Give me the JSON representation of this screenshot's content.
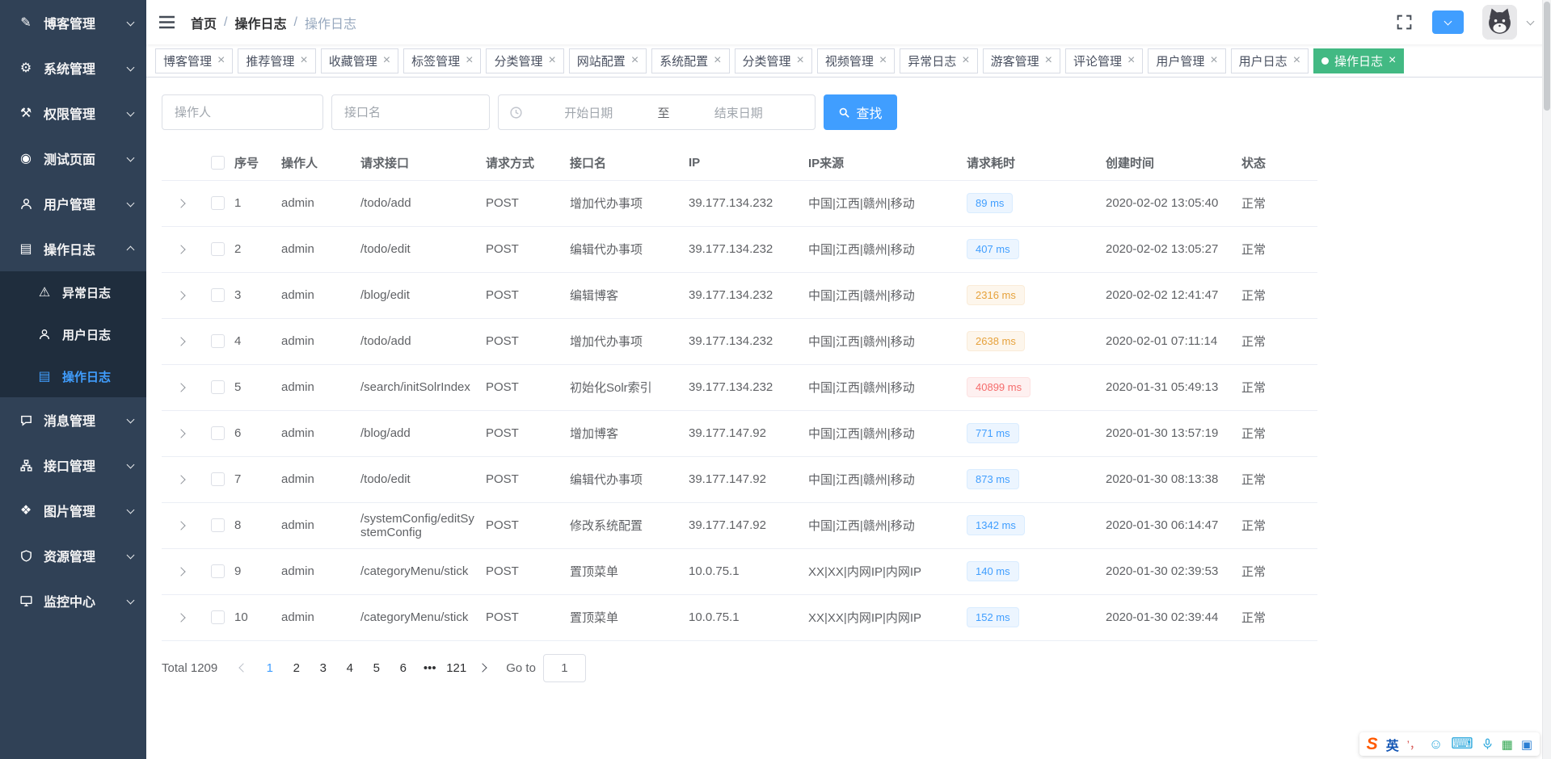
{
  "colors": {
    "primary": "#409eff",
    "active_tab_green": "#42b983",
    "sidebar_bg": "#304156",
    "submenu_bg": "#1f2d3d",
    "badge_info": "#409eff",
    "badge_warning": "#e6a23c",
    "badge_danger": "#f56c6c"
  },
  "header": {
    "breadcrumb": [
      "首页",
      "操作日志",
      "操作日志"
    ],
    "breadcrumb_separator": "/"
  },
  "sidebar": {
    "items": [
      {
        "label": "博客管理",
        "icon": "edit-icon"
      },
      {
        "label": "系统管理",
        "icon": "gear-icon"
      },
      {
        "label": "权限管理",
        "icon": "wrench-icon"
      },
      {
        "label": "测试页面",
        "icon": "target-icon"
      },
      {
        "label": "用户管理",
        "icon": "user-icon"
      },
      {
        "label": "操作日志",
        "icon": "log-icon",
        "expanded": true
      },
      {
        "label": "消息管理",
        "icon": "message-icon"
      },
      {
        "label": "接口管理",
        "icon": "api-icon"
      },
      {
        "label": "图片管理",
        "icon": "image-icon"
      },
      {
        "label": "资源管理",
        "icon": "shield-icon"
      },
      {
        "label": "监控中心",
        "icon": "monitor-icon"
      }
    ],
    "submenu": [
      {
        "label": "异常日志",
        "icon": "warning-icon"
      },
      {
        "label": "用户日志",
        "icon": "user-icon"
      },
      {
        "label": "操作日志",
        "icon": "log-icon",
        "active": true
      }
    ]
  },
  "tabs": [
    {
      "label": "博客管理"
    },
    {
      "label": "推荐管理"
    },
    {
      "label": "收藏管理"
    },
    {
      "label": "标签管理"
    },
    {
      "label": "分类管理"
    },
    {
      "label": "网站配置"
    },
    {
      "label": "系统配置"
    },
    {
      "label": "分类管理"
    },
    {
      "label": "视频管理"
    },
    {
      "label": "异常日志"
    },
    {
      "label": "游客管理"
    },
    {
      "label": "评论管理"
    },
    {
      "label": "用户管理"
    },
    {
      "label": "用户日志"
    },
    {
      "label": "操作日志",
      "active": true
    }
  ],
  "filters": {
    "operator_placeholder": "操作人",
    "api_placeholder": "接口名",
    "date_start_placeholder": "开始日期",
    "date_separator": "至",
    "date_end_placeholder": "结束日期",
    "search_label": "查找"
  },
  "table": {
    "columns": [
      "序号",
      "操作人",
      "请求接口",
      "请求方式",
      "接口名",
      "IP",
      "IP来源",
      "请求耗时",
      "创建时间",
      "状态"
    ],
    "rows": [
      {
        "seq": "1",
        "operator": "admin",
        "api": "/todo/add",
        "method": "POST",
        "api_name": "增加代办事项",
        "ip": "39.177.134.232",
        "ip_source": "中国|江西|赣州|移动",
        "duration": "89 ms",
        "duration_level": "info",
        "created": "2020-02-02 13:05:40",
        "status": "正常"
      },
      {
        "seq": "2",
        "operator": "admin",
        "api": "/todo/edit",
        "method": "POST",
        "api_name": "编辑代办事项",
        "ip": "39.177.134.232",
        "ip_source": "中国|江西|赣州|移动",
        "duration": "407 ms",
        "duration_level": "info",
        "created": "2020-02-02 13:05:27",
        "status": "正常"
      },
      {
        "seq": "3",
        "operator": "admin",
        "api": "/blog/edit",
        "method": "POST",
        "api_name": "编辑博客",
        "ip": "39.177.134.232",
        "ip_source": "中国|江西|赣州|移动",
        "duration": "2316 ms",
        "duration_level": "warning",
        "created": "2020-02-02 12:41:47",
        "status": "正常"
      },
      {
        "seq": "4",
        "operator": "admin",
        "api": "/todo/add",
        "method": "POST",
        "api_name": "增加代办事项",
        "ip": "39.177.134.232",
        "ip_source": "中国|江西|赣州|移动",
        "duration": "2638 ms",
        "duration_level": "warning",
        "created": "2020-02-01 07:11:14",
        "status": "正常"
      },
      {
        "seq": "5",
        "operator": "admin",
        "api": "/search/initSolrIndex",
        "method": "POST",
        "api_name": "初始化Solr索引",
        "ip": "39.177.134.232",
        "ip_source": "中国|江西|赣州|移动",
        "duration": "40899 ms",
        "duration_level": "danger",
        "created": "2020-01-31 05:49:13",
        "status": "正常"
      },
      {
        "seq": "6",
        "operator": "admin",
        "api": "/blog/add",
        "method": "POST",
        "api_name": "增加博客",
        "ip": "39.177.147.92",
        "ip_source": "中国|江西|赣州|移动",
        "duration": "771 ms",
        "duration_level": "info",
        "created": "2020-01-30 13:57:19",
        "status": "正常"
      },
      {
        "seq": "7",
        "operator": "admin",
        "api": "/todo/edit",
        "method": "POST",
        "api_name": "编辑代办事项",
        "ip": "39.177.147.92",
        "ip_source": "中国|江西|赣州|移动",
        "duration": "873 ms",
        "duration_level": "info",
        "created": "2020-01-30 08:13:38",
        "status": "正常"
      },
      {
        "seq": "8",
        "operator": "admin",
        "api": "/systemConfig/editSystemConfig",
        "method": "POST",
        "api_name": "修改系统配置",
        "ip": "39.177.147.92",
        "ip_source": "中国|江西|赣州|移动",
        "duration": "1342 ms",
        "duration_level": "info",
        "created": "2020-01-30 06:14:47",
        "status": "正常"
      },
      {
        "seq": "9",
        "operator": "admin",
        "api": "/categoryMenu/stick",
        "method": "POST",
        "api_name": "置顶菜单",
        "ip": "10.0.75.1",
        "ip_source": "XX|XX|内网IP|内网IP",
        "duration": "140 ms",
        "duration_level": "info",
        "created": "2020-01-30 02:39:53",
        "status": "正常"
      },
      {
        "seq": "10",
        "operator": "admin",
        "api": "/categoryMenu/stick",
        "method": "POST",
        "api_name": "置顶菜单",
        "ip": "10.0.75.1",
        "ip_source": "XX|XX|内网IP|内网IP",
        "duration": "152 ms",
        "duration_level": "info",
        "created": "2020-01-30 02:39:44",
        "status": "正常"
      }
    ]
  },
  "pagination": {
    "total_label": "Total 1209",
    "pages": [
      {
        "label": "1",
        "active": true
      },
      {
        "label": "2"
      },
      {
        "label": "3"
      },
      {
        "label": "4"
      },
      {
        "label": "5"
      },
      {
        "label": "6"
      },
      {
        "label": "•••"
      },
      {
        "label": "121"
      }
    ],
    "goto_label": "Go to",
    "goto_value": "1"
  },
  "ime": {
    "logo": "S",
    "language": "英"
  }
}
